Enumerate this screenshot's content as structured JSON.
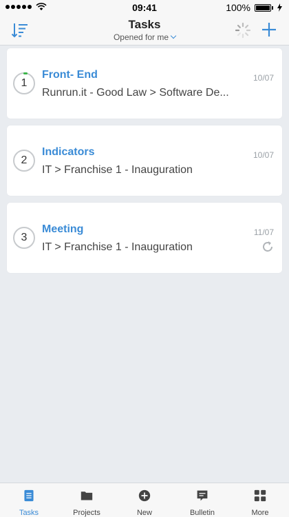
{
  "status_bar": {
    "time": "09:41",
    "battery": "100%"
  },
  "nav": {
    "title": "Tasks",
    "subtitle": "Opened for me"
  },
  "tasks": [
    {
      "number": "1",
      "title": "Front- End",
      "path": "Runrun.it - Good Law > Software De...",
      "date": "10/07"
    },
    {
      "number": "2",
      "title": "Indicators",
      "path": "IT > Franchise 1 - Inauguration",
      "date": "10/07"
    },
    {
      "number": "3",
      "title": "Meeting",
      "path": "IT > Franchise 1 - Inauguration",
      "date": "11/07"
    }
  ],
  "tab_bar": [
    {
      "label": "Tasks",
      "icon": "tasks-icon"
    },
    {
      "label": "Projects",
      "icon": "folder-icon"
    },
    {
      "label": "New",
      "icon": "add-circle-icon"
    },
    {
      "label": "Bulletin",
      "icon": "bulletin-icon"
    },
    {
      "label": "More",
      "icon": "grid-icon"
    }
  ],
  "colors": {
    "accent": "#3a8bd6",
    "progress": "#3cb54a"
  }
}
